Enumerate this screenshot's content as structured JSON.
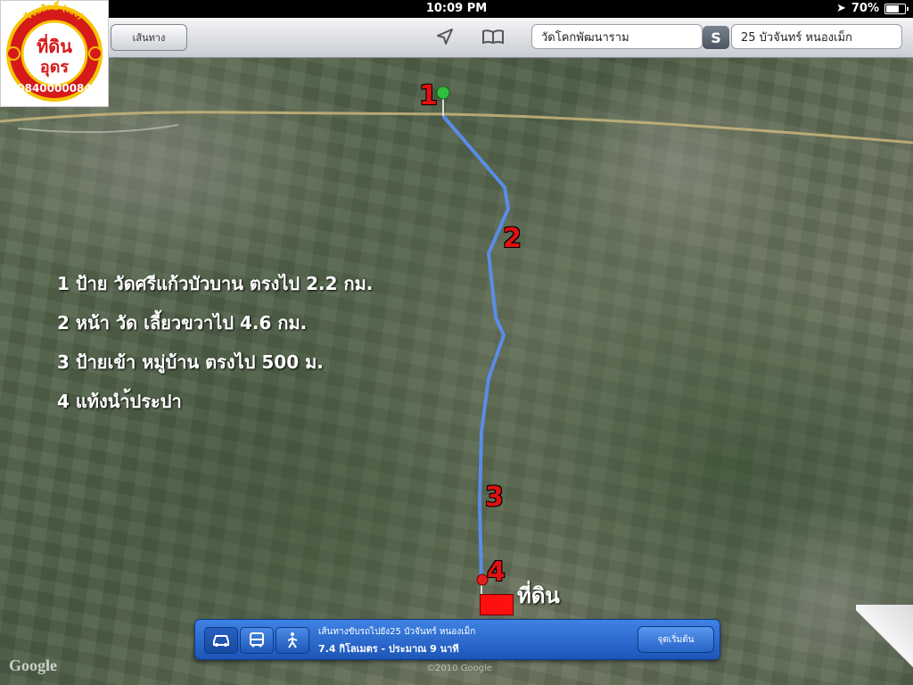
{
  "status_bar": {
    "time": "10:09 PM",
    "battery_text": "70%",
    "battery_level": 0.7
  },
  "toolbar": {
    "route_button": "เส้นทาง",
    "from_field": "วัดโคกพัฒนาราม",
    "to_field": "25 บัวจันทร์ หนองเม็ก",
    "swap_label": "S"
  },
  "logo": {
    "top_text": "ไชยสิทธิ์ (เฮง)",
    "line1": "ที่ดิน",
    "line2": "อุดร",
    "phone": "0840000084"
  },
  "directions": [
    "1 ป้าย วัดศรีแก้วบัวบาน ตรงไป 2.2 กม.",
    "2 หน้า วัด เลี้ยวขวาไป 4.6 กม.",
    "3 ป้ายเข้า หมู่บ้าน ตรงไป 500 ม.",
    "4 แท้งนำ้ประปา"
  ],
  "markers": {
    "m1": "1",
    "m2": "2",
    "m3": "3",
    "m4": "4",
    "land": "ที่ดิน"
  },
  "map_labels": {
    "google": "Google",
    "copyright": "©2010 Google"
  },
  "panel": {
    "route_title": "เส้นทางขับรถไปยัง25 บัวจันทร์ หนองเม็ก",
    "route_info": "7.4 กิโลเมตร - ประมาณ 9 นาที",
    "start_button": "จุดเริ่มต้น"
  },
  "colors": {
    "route": "#5a8ef0",
    "marker": "#e01010",
    "start_pin": "#2fbf3f",
    "end_pin": "#e02020"
  }
}
